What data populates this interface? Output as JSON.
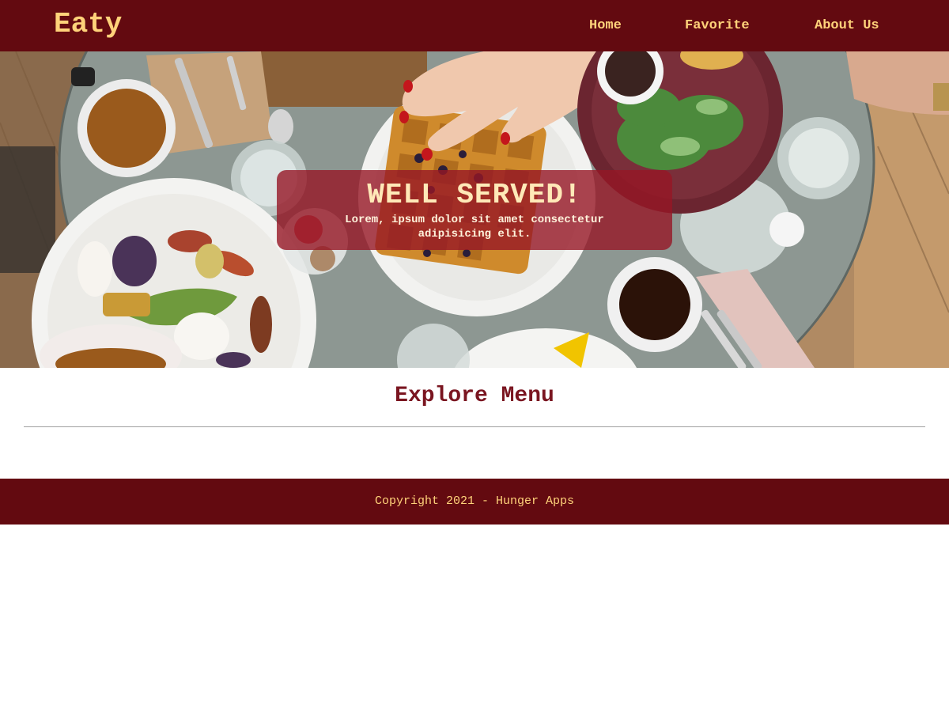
{
  "header": {
    "brand": "Eaty",
    "nav": {
      "home": "Home",
      "favorite": "Favorite",
      "about": "About Us"
    }
  },
  "hero": {
    "title": "WELL SERVED!",
    "subtitle": "Lorem, ipsum dolor sit amet consectetur adipisicing elit."
  },
  "main": {
    "section_title": "Explore Menu"
  },
  "footer": {
    "copyright": "Copyright 2021 - Hunger Apps"
  },
  "colors": {
    "header_bg": "#630a10",
    "accent_text": "#ffd27a",
    "hero_card_bg": "#961626",
    "section_title": "#7a1520"
  }
}
